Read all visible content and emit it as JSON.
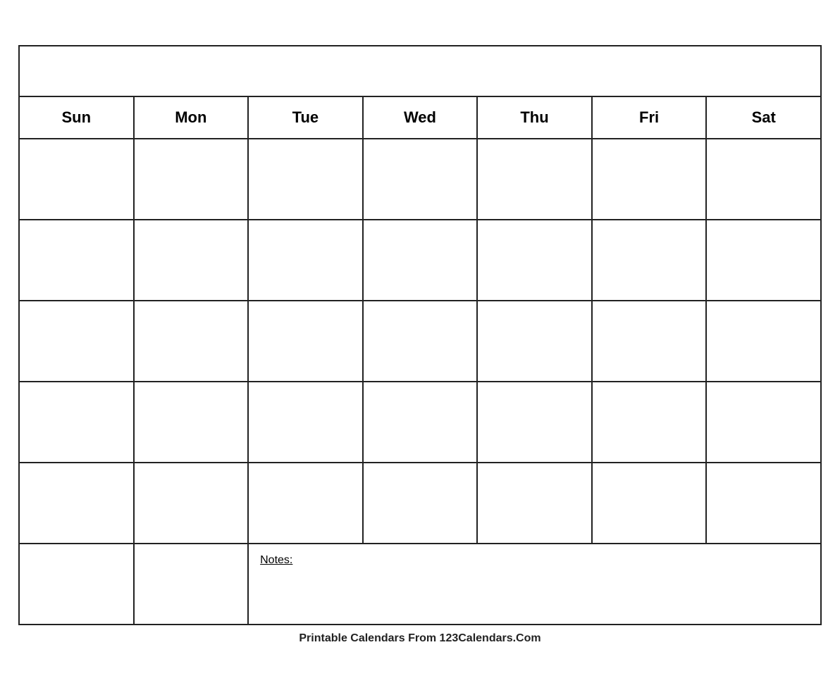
{
  "calendar": {
    "title": "",
    "days": [
      "Sun",
      "Mon",
      "Tue",
      "Wed",
      "Thu",
      "Fri",
      "Sat"
    ],
    "notes_label": "Notes:",
    "footer_text": "Printable Calendars From ",
    "footer_brand": "123Calendars.Com"
  }
}
